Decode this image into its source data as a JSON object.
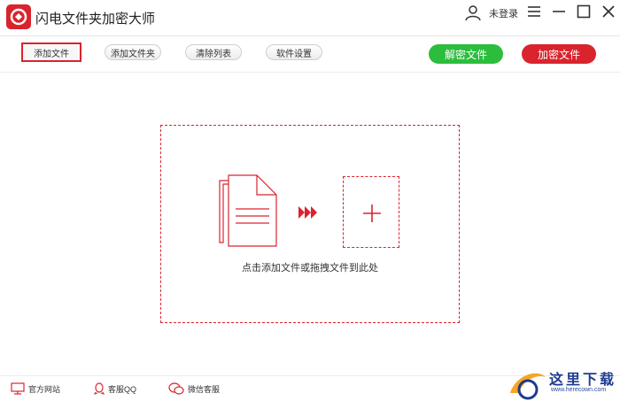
{
  "app": {
    "title": "闪电文件夹加密大师",
    "login_label": "未登录"
  },
  "toolbar": {
    "add_file": "添加文件",
    "add_folder": "添加文件夹",
    "clear_list": "清除列表",
    "settings": "软件设置",
    "decrypt": "解密文件",
    "encrypt": "加密文件"
  },
  "main": {
    "drop_hint": "点击添加文件或拖拽文件到此处"
  },
  "footer": {
    "official_site": "官方网站",
    "qq_service": "客服QQ",
    "wechat_service": "微信客服"
  },
  "watermark": {
    "text": "这里下载",
    "url": "www.herecown.com"
  },
  "colors": {
    "accent": "#d9242e",
    "decrypt": "#2dbd3d",
    "encrypt": "#d9242e",
    "watermark": "#1d3b8f"
  }
}
